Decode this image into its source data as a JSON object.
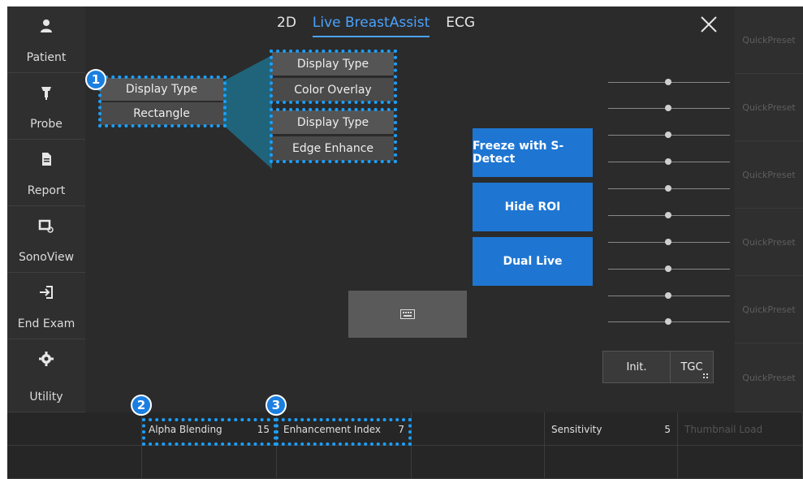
{
  "sidebar": {
    "items": [
      {
        "label": "Patient",
        "icon": "user-icon"
      },
      {
        "label": "Probe",
        "icon": "probe-icon"
      },
      {
        "label": "Report",
        "icon": "document-icon"
      },
      {
        "label": "SonoView",
        "icon": "sonoview-icon"
      },
      {
        "label": "End Exam",
        "icon": "exit-icon"
      },
      {
        "label": "Utility",
        "icon": "gear-icon"
      }
    ]
  },
  "tabs": [
    {
      "label": "2D",
      "active": false
    },
    {
      "label": "Live BreastAssist",
      "active": true
    },
    {
      "label": "ECG",
      "active": false
    }
  ],
  "display_type": {
    "main": {
      "label": "Display Type",
      "value": "Rectangle"
    },
    "option1": {
      "label": "Display Type",
      "value": "Color Overlay"
    },
    "option2": {
      "label": "Display Type",
      "value": "Edge Enhance"
    }
  },
  "buttons": {
    "freeze": "Freeze with S-Detect",
    "hide_roi": "Hide ROI",
    "dual_live": "Dual Live",
    "init": "Init.",
    "tgc": "TGC"
  },
  "callouts": [
    "1",
    "2",
    "3"
  ],
  "quickpresets": [
    "QuickPreset",
    "QuickPreset",
    "QuickPreset",
    "QuickPreset",
    "QuickPreset",
    "QuickPreset"
  ],
  "bottom": {
    "alpha_blending": {
      "label": "Alpha Blending",
      "value": "15"
    },
    "enhancement_index": {
      "label": "Enhancement Index",
      "value": "7"
    },
    "sensitivity": {
      "label": "Sensitivity",
      "value": "5"
    },
    "thumbnail_load": "Thumbnail Load"
  },
  "colors": {
    "accent_blue": "#1e76d2",
    "tab_blue": "#4aa3ff",
    "callout_blue": "#1aa0ff"
  }
}
